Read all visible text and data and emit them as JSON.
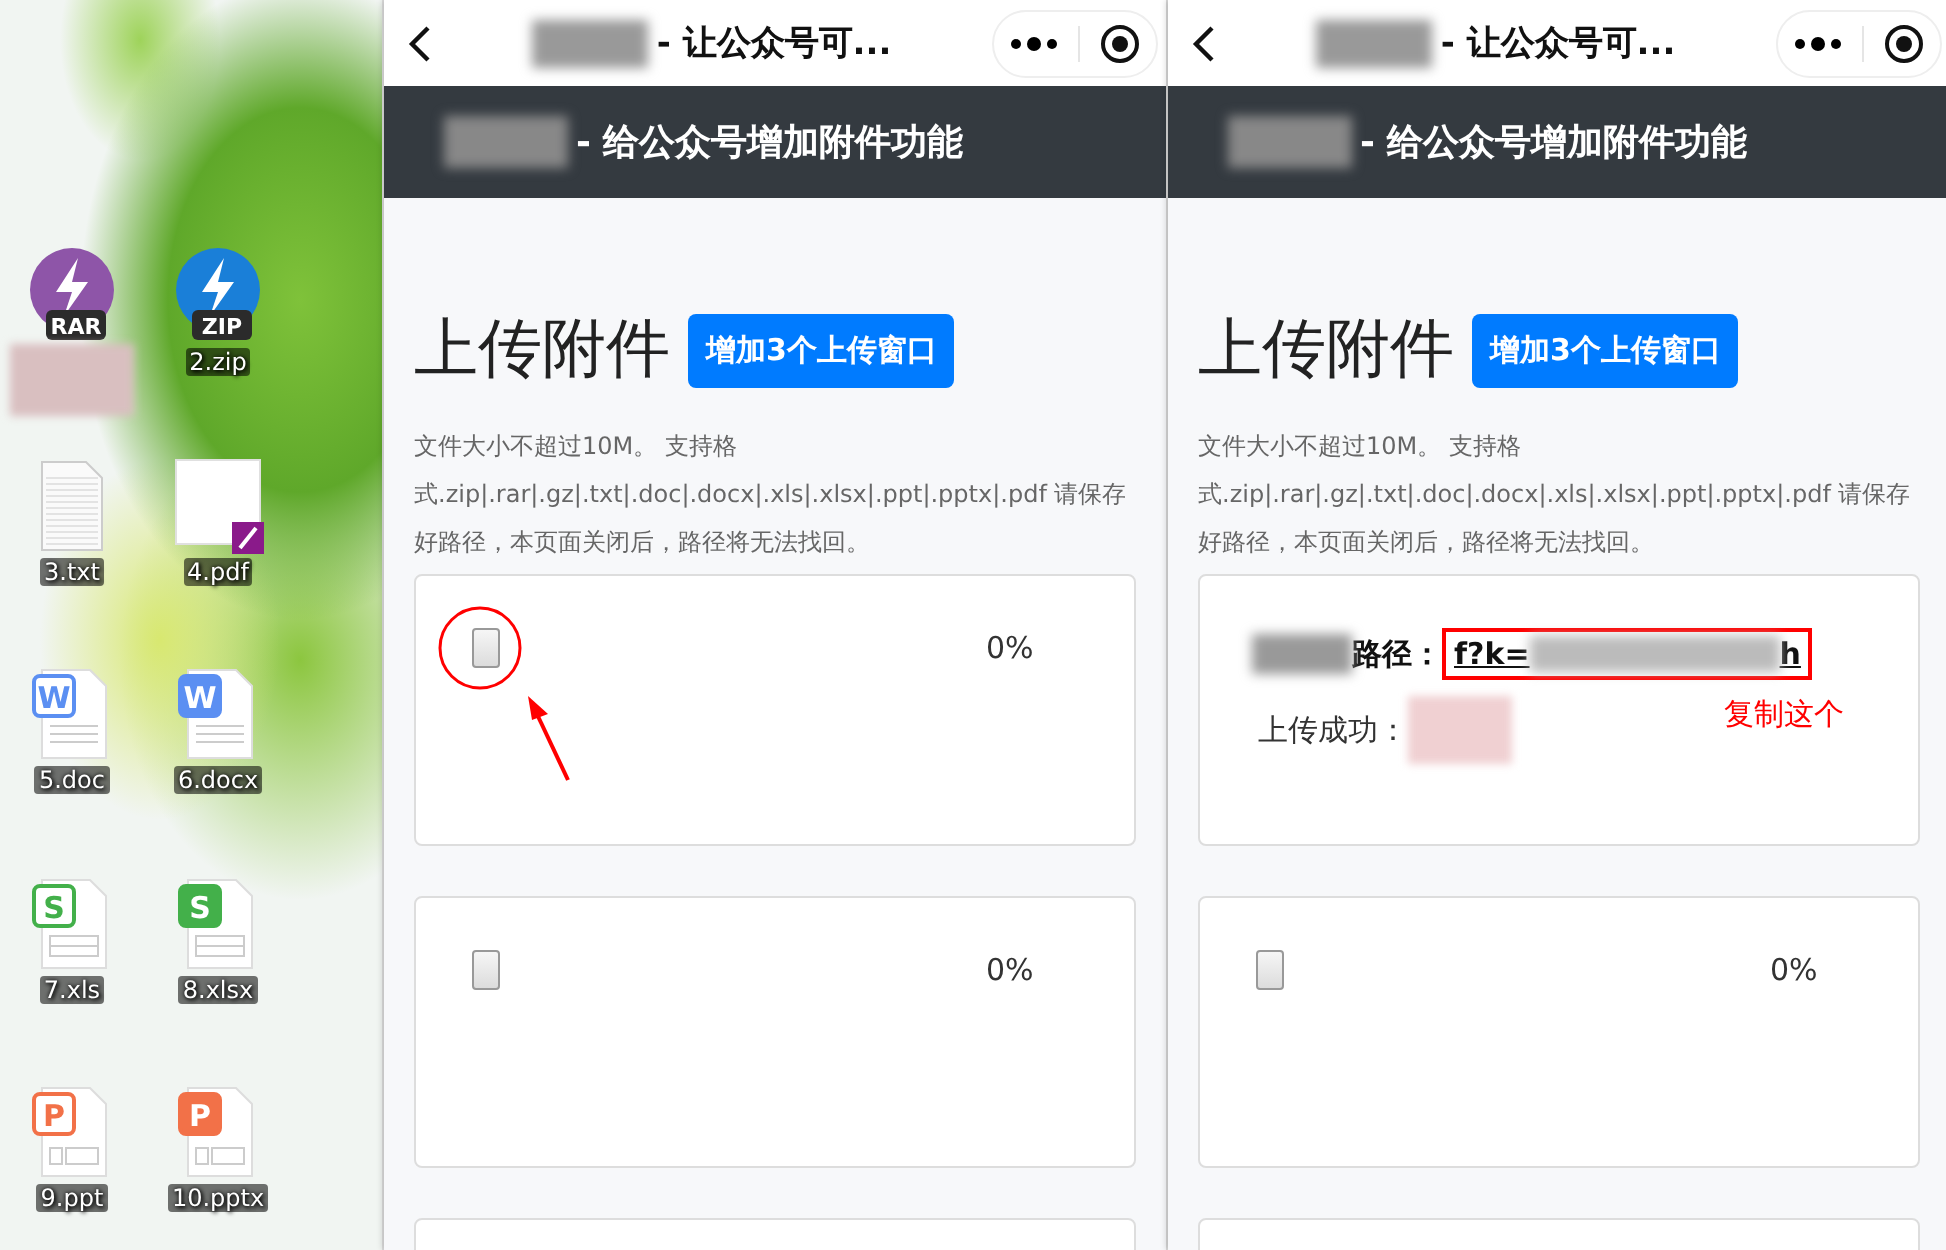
{
  "desktop": {
    "icons": [
      {
        "kind": "rar",
        "badge": "RAR"
      },
      {
        "kind": "zip",
        "badge": "ZIP",
        "label": "2.zip"
      },
      {
        "kind": "txt",
        "label": "3.txt"
      },
      {
        "kind": "pdf",
        "label": "4.pdf"
      },
      {
        "kind": "doc",
        "badge": "W",
        "label": "5.doc"
      },
      {
        "kind": "docx",
        "badge": "W",
        "label": "6.docx"
      },
      {
        "kind": "xls",
        "badge": "S",
        "label": "7.xls"
      },
      {
        "kind": "xlsx",
        "badge": "S",
        "label": "8.xlsx"
      },
      {
        "kind": "ppt",
        "badge": "P",
        "label": "9.ppt"
      },
      {
        "kind": "pptx",
        "badge": "P",
        "label": "10.pptx"
      }
    ]
  },
  "phones": [
    {
      "nav_title": "- 让公众号可...",
      "header_title": "- 给公众号增加附件功能",
      "heading": "上传附件",
      "add_button": "增加3个上传窗口",
      "notice": "文件大小不超过10M。 支持格式.zip|.rar|.gz|.txt|.doc|.docx|.xls|.xlsx|.ppt|.pptx|.pdf 请保存好路径，本页面关闭后，路径将无法找回。",
      "slots": [
        {
          "kind": "pending",
          "percent": "0%",
          "highlighted": true
        },
        {
          "kind": "pending",
          "percent": "0%",
          "highlighted": false
        },
        {
          "kind": "pending"
        }
      ]
    },
    {
      "nav_title": "- 让公众号可...",
      "header_title": "- 给公众号增加附件功能",
      "heading": "上传附件",
      "add_button": "增加3个上传窗口",
      "notice": "文件大小不超过10M。 支持格式.zip|.rar|.gz|.txt|.doc|.docx|.xls|.xlsx|.ppt|.pptx|.pdf 请保存好路径，本页面关闭后，路径将无法找回。",
      "slots": [
        {
          "kind": "done",
          "path_label": "路径：",
          "link_start": "f?k=",
          "link_end": "h",
          "success_label": "上传成功：",
          "highlighted": true,
          "annotation": "复制这个"
        },
        {
          "kind": "pending",
          "percent": "0%",
          "highlighted": false
        },
        {
          "kind": "pending"
        }
      ]
    }
  ]
}
